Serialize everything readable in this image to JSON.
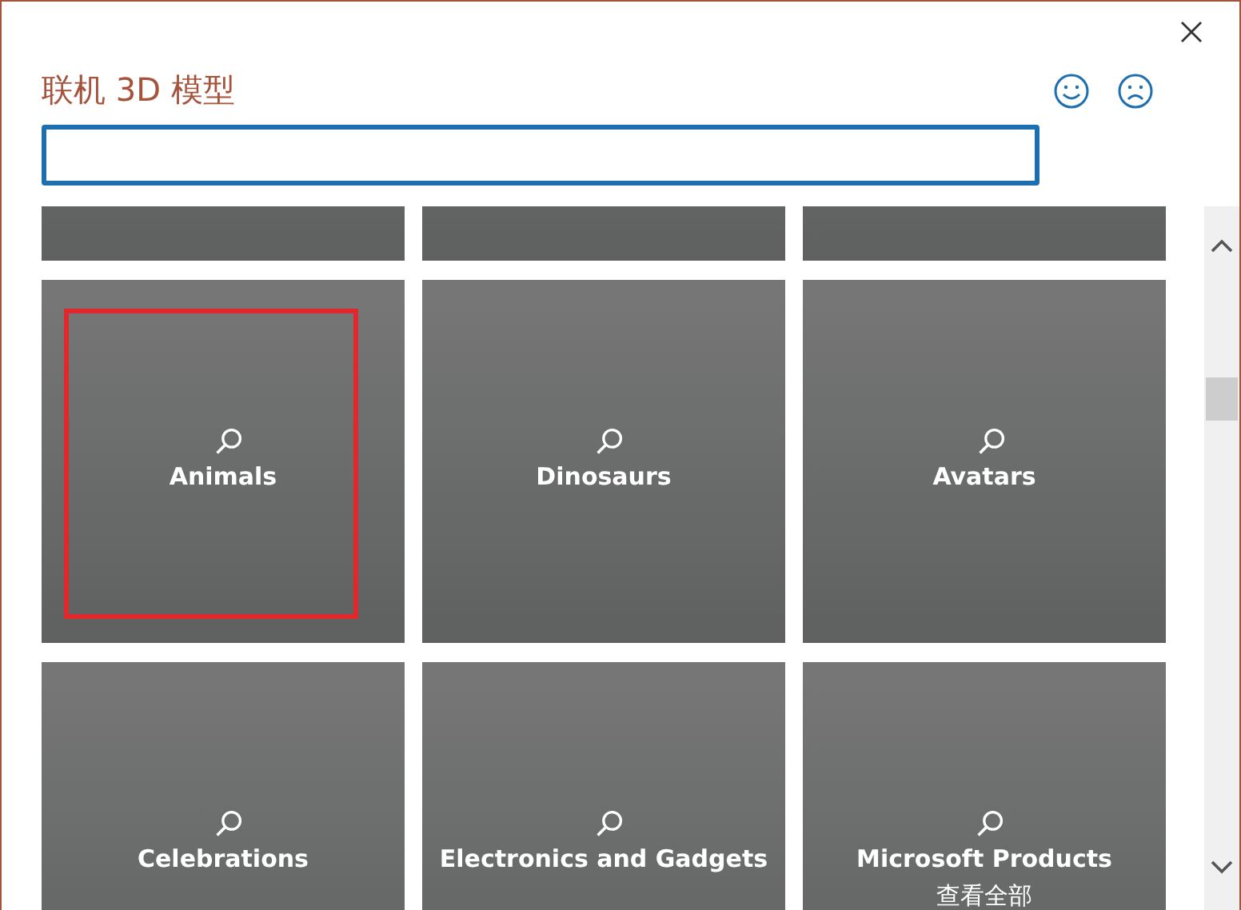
{
  "dialog": {
    "title": "联机 3D 模型"
  },
  "tiles": [
    {
      "highlighted": false
    },
    {
      "highlighted": false
    },
    {
      "highlighted": false
    },
    {
      "label": "Animals",
      "highlighted": true
    },
    {
      "label": "Dinosaurs",
      "highlighted": false
    },
    {
      "label": "Avatars",
      "highlighted": false
    },
    {
      "label": "Celebrations",
      "highlighted": false
    },
    {
      "label": "Electronics and Gadgets",
      "highlighted": false
    },
    {
      "label": "Microsoft Products",
      "sublabel": "查看全部",
      "highlighted": false
    }
  ]
}
